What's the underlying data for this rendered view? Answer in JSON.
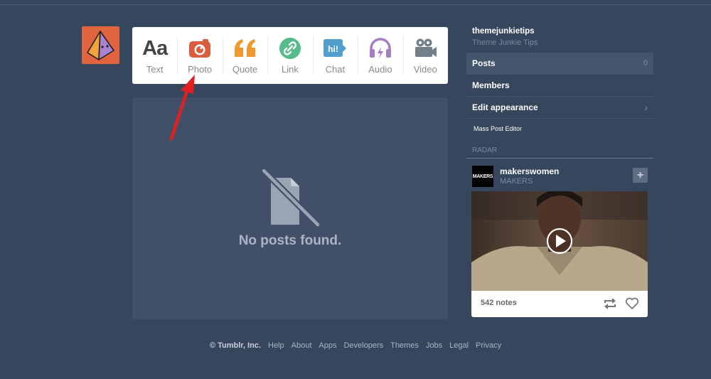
{
  "blog": {
    "avatar_icon": "pyramid-avatar-icon"
  },
  "post_types": [
    {
      "label": "Text",
      "icon": "text-aa-icon",
      "color": "#444444"
    },
    {
      "label": "Photo",
      "icon": "camera-icon",
      "color": "#d95e40"
    },
    {
      "label": "Quote",
      "icon": "quote-icon",
      "color": "#f2992e"
    },
    {
      "label": "Link",
      "icon": "link-icon",
      "color": "#56bc8a"
    },
    {
      "label": "Chat",
      "icon": "chat-bubble-icon",
      "color": "#529ecc",
      "icon_text": "hi!"
    },
    {
      "label": "Audio",
      "icon": "headphones-icon",
      "color": "#a77dc2"
    },
    {
      "label": "Video",
      "icon": "video-camera-icon",
      "color": "#748089"
    }
  ],
  "empty_state": {
    "text": "No posts found.",
    "icon": "no-document-icon"
  },
  "sidebar": {
    "blog_name": "themejunkietips",
    "blog_title": "Theme Junkie Tips",
    "menu": [
      {
        "label": "Posts",
        "count": "0",
        "active": true
      },
      {
        "label": "Members"
      },
      {
        "label": "Edit appearance",
        "chevron": "›"
      },
      {
        "label": "Mass Post Editor"
      }
    ]
  },
  "radar": {
    "heading": "RADAR",
    "avatar_text": "MAKERS",
    "blog_name": "makerswomen",
    "blog_title": "MAKERS",
    "follow_label": "+",
    "notes": "542 notes"
  },
  "footer": {
    "copyright": "© Tumblr, Inc.",
    "links": [
      "Help",
      "About",
      "Apps",
      "Developers",
      "Themes",
      "Jobs",
      "Legal",
      "Privacy"
    ]
  },
  "colors": {
    "background": "#36465d",
    "panel": "#415068",
    "annotation_arrow": "#e02020"
  }
}
